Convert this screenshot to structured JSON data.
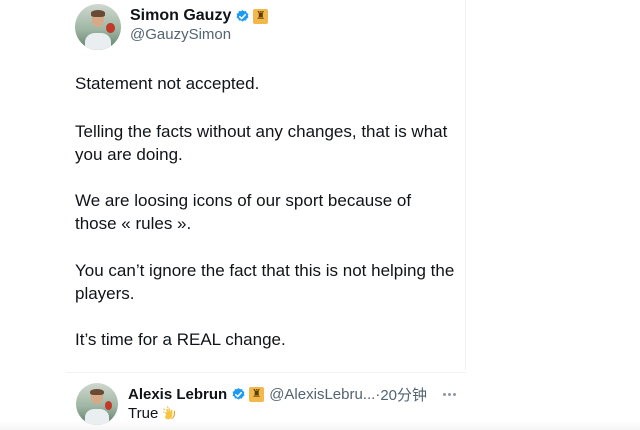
{
  "post": {
    "author": {
      "display_name": "Simon Gauzy",
      "handle": "@GauzySimon",
      "flag_glyph": "♜",
      "avatar_icon": "user-avatar-icon"
    },
    "paragraphs": [
      "Statement not accepted.",
      "Telling the facts without any changes, that is what you are doing.",
      "We are loosing icons of our sport because of those « rules ».",
      "You can’t ignore the fact that this is not helping the players.",
      "It’s time for a REAL change."
    ]
  },
  "reply": {
    "author": {
      "display_name": "Alexis Lebrun",
      "handle": "@AlexisLebru...",
      "separator": " · ",
      "time": "20分钟",
      "flag_glyph": "♜"
    },
    "text": "True",
    "emoji_icon": "clapping-hands-icon"
  },
  "colors": {
    "text": "#0f1419",
    "secondary": "#536471",
    "verified": "#1d9bf0",
    "flag": "#f2b84b",
    "divider": "#eff3f4"
  }
}
